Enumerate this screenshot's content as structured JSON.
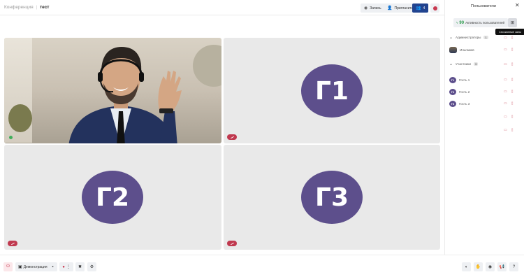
{
  "header": {
    "app_title": "Конференция",
    "room_name": "тест",
    "buttons": [
      {
        "label": "Запись",
        "icon": "record-icon"
      },
      {
        "label": "Пригласить",
        "icon": "invite-user-icon"
      },
      {
        "label": "4",
        "icon": "participants-icon"
      },
      {
        "label": "",
        "icon": "stop-icon"
      }
    ]
  },
  "tiles": [
    {
      "type": "video",
      "muted": false
    },
    {
      "type": "avatar",
      "initials": "Г1",
      "muted": true
    },
    {
      "type": "avatar",
      "initials": "Г2",
      "muted": true
    },
    {
      "type": "avatar",
      "initials": "Г3",
      "muted": true
    }
  ],
  "panel": {
    "title": "Пользователи",
    "activate_count": "90",
    "activate_label": "Активность пользователей",
    "session_tooltip": "Сессионные залы",
    "groups": [
      {
        "label": "Администраторы",
        "count": "1"
      },
      {
        "label": "Участники",
        "count": "3"
      }
    ],
    "users": [
      {
        "name": "Ильгамов",
        "initials": "",
        "group": "admin"
      },
      {
        "name": "Гость 1",
        "initials": "Г1",
        "group": "participants"
      },
      {
        "name": "Гость 2",
        "initials": "Г2",
        "group": "participants"
      },
      {
        "name": "Гость 3",
        "initials": "Г3",
        "group": "participants"
      }
    ]
  },
  "bottom": {
    "demo_label": "Демонстрация"
  },
  "colors": {
    "avatar": "#5d4f8c",
    "accent": "#21438f",
    "danger": "#c8384f"
  }
}
